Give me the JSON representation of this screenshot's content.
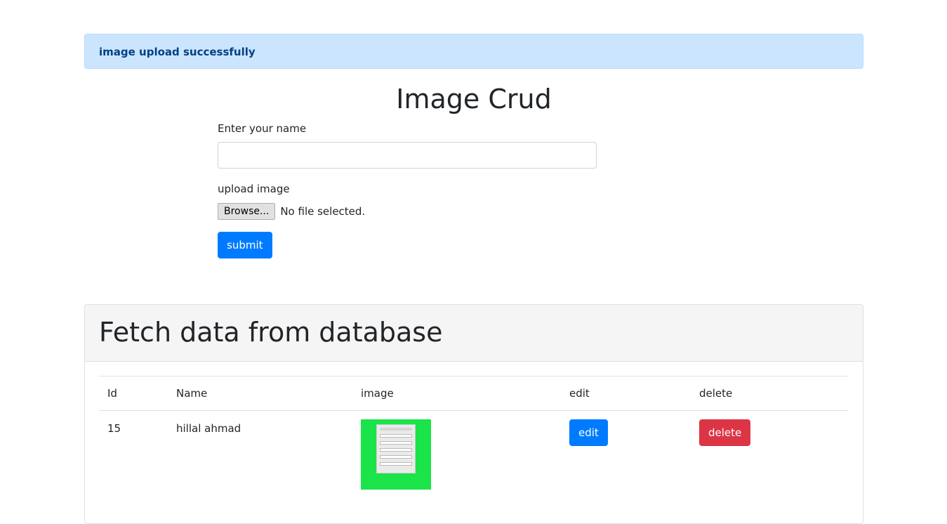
{
  "alert": {
    "message": "image upload successfully"
  },
  "page": {
    "title": "Image Crud"
  },
  "form": {
    "name_label": "Enter your name",
    "name_value": "",
    "upload_label": "upload image",
    "browse_label": "Browse...",
    "file_status": "No file selected.",
    "submit_label": "submit"
  },
  "card": {
    "title": "Fetch data from database"
  },
  "table": {
    "headers": {
      "id": "Id",
      "name": "Name",
      "image": "image",
      "edit": "edit",
      "delete": "delete"
    },
    "rows": [
      {
        "id": "15",
        "name": "hillal ahmad",
        "edit_label": "edit",
        "delete_label": "delete"
      }
    ]
  },
  "colors": {
    "primary": "#007bff",
    "danger": "#dc3545",
    "alert_bg": "#cce5ff",
    "alert_text": "#004085",
    "thumbnail_bg": "#1ae449"
  }
}
